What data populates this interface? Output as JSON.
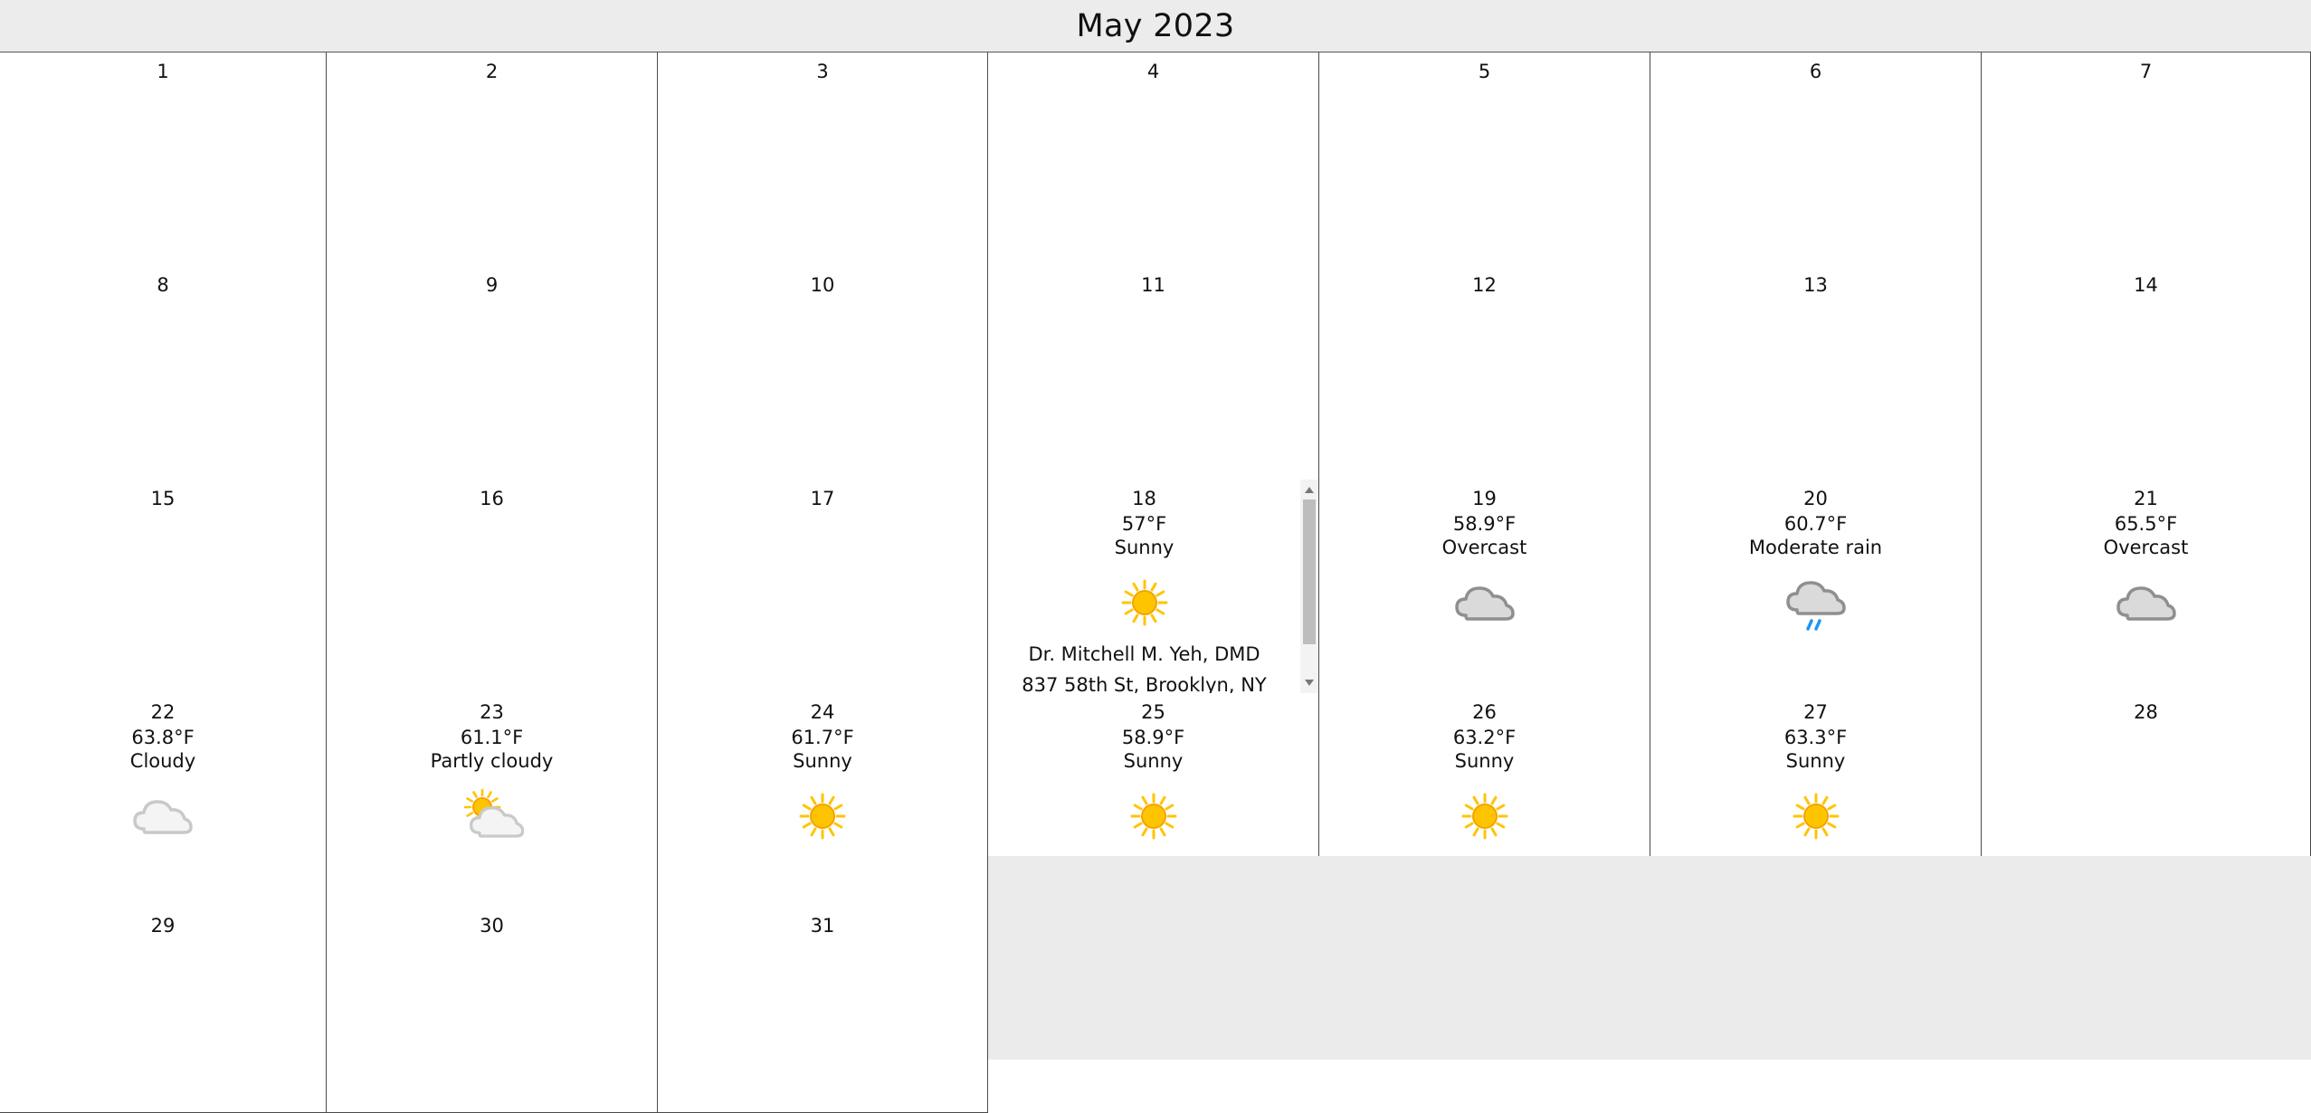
{
  "calendar": {
    "month_title": "May 2023",
    "weeks": [
      [
        {
          "day": "1"
        },
        {
          "day": "2"
        },
        {
          "day": "3"
        },
        {
          "day": "4"
        },
        {
          "day": "5"
        },
        {
          "day": "6"
        },
        {
          "day": "7"
        }
      ],
      [
        {
          "day": "8"
        },
        {
          "day": "9"
        },
        {
          "day": "10"
        },
        {
          "day": "11"
        },
        {
          "day": "12"
        },
        {
          "day": "13"
        },
        {
          "day": "14"
        }
      ],
      [
        {
          "day": "15"
        },
        {
          "day": "16"
        },
        {
          "day": "17"
        },
        {
          "day": "18",
          "temp": "57°F",
          "condition": "Sunny",
          "icon": "sunny-icon",
          "appointment": {
            "name": "Dr. Mitchell M. Yeh, DMD",
            "address": "837 58th St, Brooklyn, NY"
          }
        },
        {
          "day": "19",
          "temp": "58.9°F",
          "condition": "Overcast",
          "icon": "overcast-icon"
        },
        {
          "day": "20",
          "temp": "60.7°F",
          "condition": "Moderate rain",
          "icon": "rain-icon"
        },
        {
          "day": "21",
          "temp": "65.5°F",
          "condition": "Overcast",
          "icon": "overcast-icon"
        }
      ],
      [
        {
          "day": "22",
          "temp": "63.8°F",
          "condition": "Cloudy",
          "icon": "cloudy-icon"
        },
        {
          "day": "23",
          "temp": "61.1°F",
          "condition": "Partly cloudy",
          "icon": "partly-cloudy-icon"
        },
        {
          "day": "24",
          "temp": "61.7°F",
          "condition": "Sunny",
          "icon": "sunny-icon"
        },
        {
          "day": "25",
          "temp": "58.9°F",
          "condition": "Sunny",
          "icon": "sunny-icon"
        },
        {
          "day": "26",
          "temp": "63.2°F",
          "condition": "Sunny",
          "icon": "sunny-icon"
        },
        {
          "day": "27",
          "temp": "63.3°F",
          "condition": "Sunny",
          "icon": "sunny-icon"
        },
        {
          "day": "28"
        }
      ],
      [
        {
          "day": "29"
        },
        {
          "day": "30"
        },
        {
          "day": "31"
        }
      ]
    ]
  },
  "colors": {
    "header_bg": "#ececec",
    "grid_line": "#4a4a4a",
    "empty_bg": "#ebebeb",
    "sun": "#ffc400",
    "cloud_gray": "#9e9e9e",
    "rain": "#2196f3"
  }
}
